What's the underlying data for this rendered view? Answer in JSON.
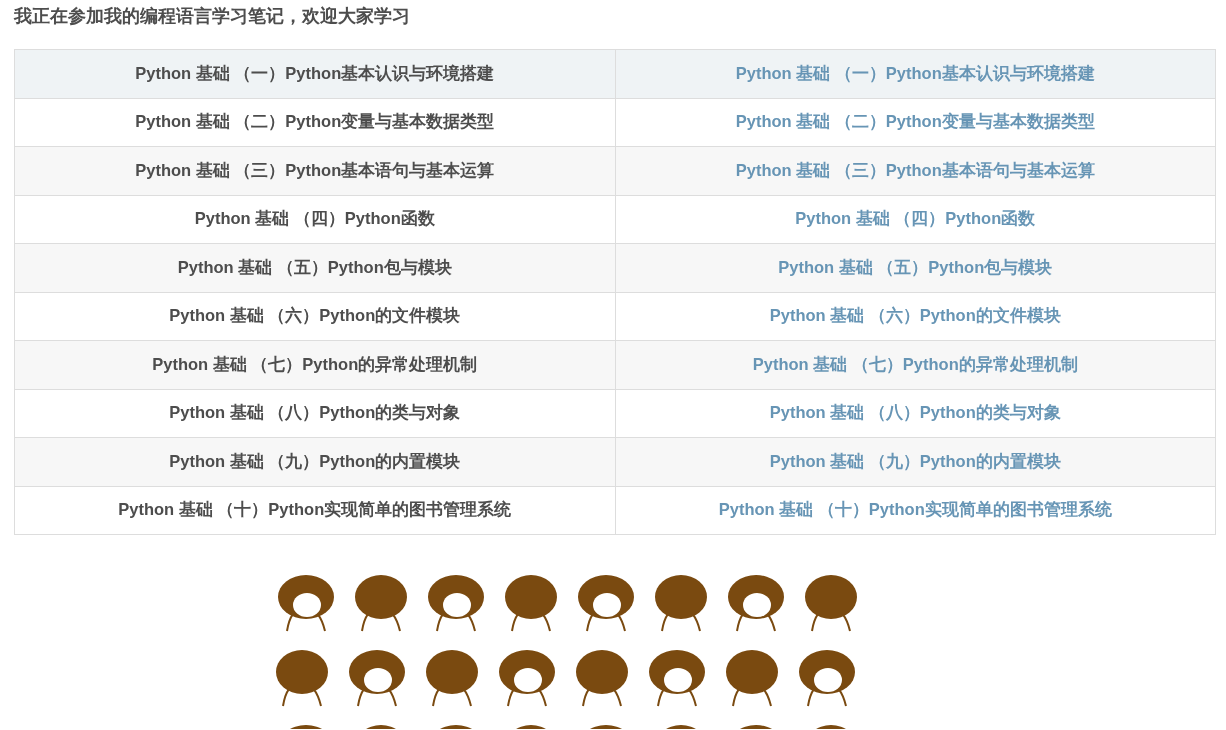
{
  "heading": "我正在参加我的编程语言学习笔记，欢迎大家学习",
  "table": {
    "rows": [
      {
        "kind": "header",
        "left": "Python 基础 （一）Python基本认识与环境搭建",
        "right": "Python 基础 （一）Python基本认识与环境搭建"
      },
      {
        "kind": "body",
        "left": "Python 基础 （二）Python变量与基本数据类型",
        "right": "Python 基础 （二）Python变量与基本数据类型"
      },
      {
        "kind": "body",
        "left": "Python 基础 （三）Python基本语句与基本运算",
        "right": "Python 基础 （三）Python基本语句与基本运算"
      },
      {
        "kind": "body",
        "left": "Python 基础 （四）Python函数",
        "right": "Python 基础 （四）Python函数"
      },
      {
        "kind": "body",
        "left": "Python 基础 （五）Python包与模块",
        "right": "Python 基础 （五）Python包与模块"
      },
      {
        "kind": "body",
        "left": "Python 基础 （六）Python的文件模块",
        "right": "Python 基础 （六）Python的文件模块"
      },
      {
        "kind": "body",
        "left": "Python 基础 （七）Python的异常处理机制",
        "right": "Python 基础 （七）Python的异常处理机制"
      },
      {
        "kind": "body",
        "left": "Python 基础 （八）Python的类与对象",
        "right": "Python 基础 （八）Python的类与对象"
      },
      {
        "kind": "body",
        "left": "Python 基础 （九）Python的内置模块",
        "right": "Python 基础 （九）Python的内置模块"
      },
      {
        "kind": "body",
        "left": "Python 基础 （十）Python实现简单的图书管理系统",
        "right": "Python 基础 （十）Python实现简单的图书管理系统"
      }
    ]
  }
}
